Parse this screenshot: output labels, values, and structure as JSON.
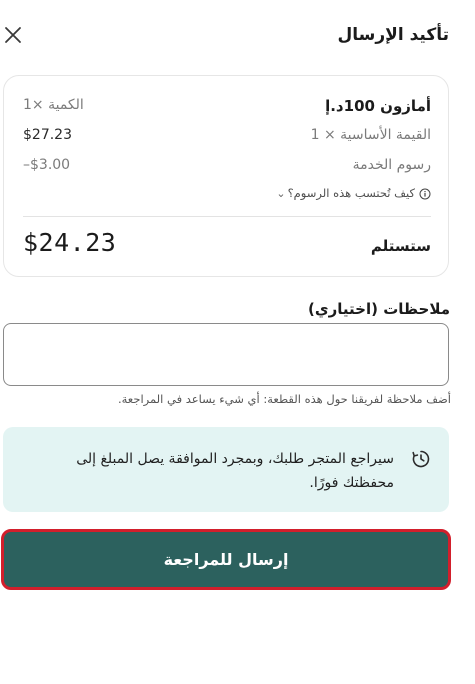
{
  "header": {
    "title": "تأكيد الإرسال",
    "close_icon": "close-icon"
  },
  "summary": {
    "product_name": "أمازون 100د.إ",
    "quantity": "الكمية ×1",
    "base_value_label": "القيمة الأساسية × 1",
    "base_value": "$27.23",
    "service_fee_label": "رسوم الخدمة",
    "service_fee": "–$3.00",
    "fee_help_link": "كيف تُحتسب هذه الرسوم؟",
    "total_label": "ستستلم",
    "total_value": "$24.23"
  },
  "notes": {
    "label": "ملاحظات (اختياري)",
    "value": "",
    "placeholder": "",
    "help_text": "أضف ملاحظة لفريقنا حول هذه القطعة: أي شيء يساعد في المراجعة."
  },
  "info": {
    "icon": "clock-icon",
    "message": "سيراجع المتجر طلبك، وبمجرد الموافقة يصل المبلغ إلى محفظتك فورًا."
  },
  "submit": {
    "label": "إرسال للمراجعة"
  },
  "colors": {
    "primary": "#2c615e",
    "info_bg": "#e3f4f3",
    "focus_ring": "#d21f2c"
  }
}
